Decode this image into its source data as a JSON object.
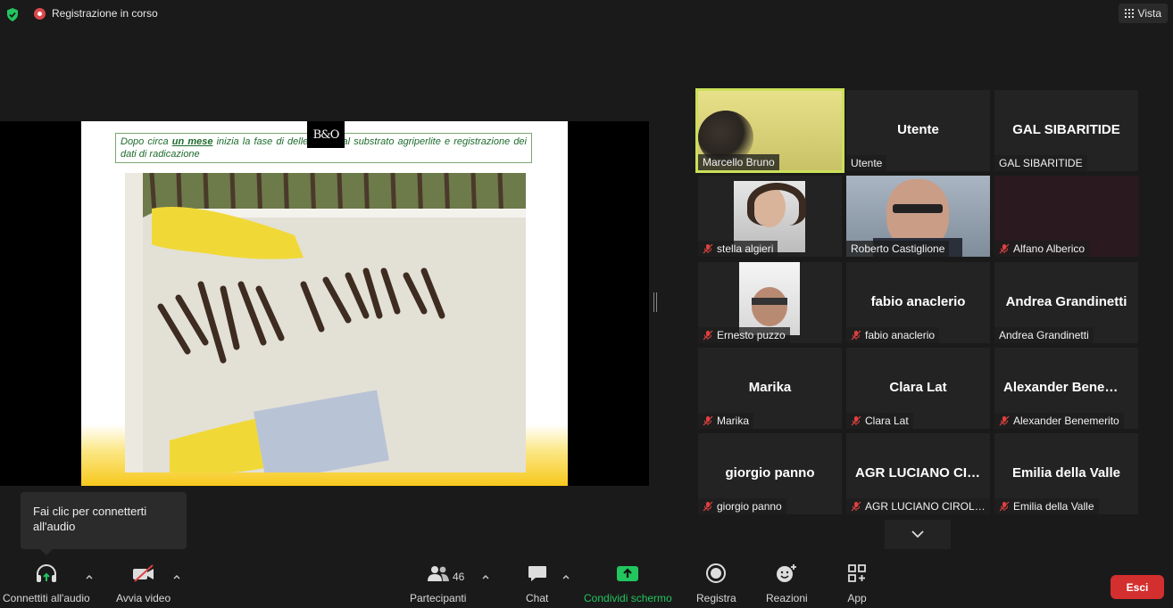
{
  "top_bar": {
    "recording_label": "Registrazione in corso",
    "view_label": "Vista"
  },
  "share": {
    "caption_pre": "Dopo circa ",
    "caption_bold": "un mese",
    "caption_post": " inizia la fase di         delle talee dal substrato agriperlite e registrazione dei dati di radicazione",
    "logo_text": "B&O"
  },
  "participants": [
    {
      "tile_name": "",
      "label": "Marcello Bruno",
      "muted": false,
      "video": true
    },
    {
      "tile_name": "Utente",
      "label": "Utente",
      "muted": false,
      "video": false
    },
    {
      "tile_name": "GAL SIBARITIDE",
      "label": "GAL SIBARITIDE",
      "muted": false,
      "video": false
    },
    {
      "tile_name": "",
      "label": "stella algieri",
      "muted": true,
      "video": true
    },
    {
      "tile_name": "",
      "label": "Roberto Castiglione",
      "muted": false,
      "video": true
    },
    {
      "tile_name": "",
      "label": "Alfano Alberico",
      "muted": true,
      "video": false
    },
    {
      "tile_name": "",
      "label": "Ernesto puzzo",
      "muted": true,
      "video": true
    },
    {
      "tile_name": "fabio anaclerio",
      "label": "fabio anaclerio",
      "muted": true,
      "video": false
    },
    {
      "tile_name": "Andrea  Grandinetti",
      "label": "Andrea Grandinetti",
      "muted": false,
      "video": false
    },
    {
      "tile_name": "Marika",
      "label": "Marika",
      "muted": true,
      "video": false
    },
    {
      "tile_name": "Clara Lat",
      "label": "Clara Lat",
      "muted": true,
      "video": false
    },
    {
      "tile_name": "Alexander  Benemerito",
      "label": "Alexander Benemerito",
      "muted": true,
      "video": false
    },
    {
      "tile_name": "giorgio panno",
      "label": "giorgio panno",
      "muted": true,
      "video": false
    },
    {
      "tile_name": "AGR LUCIANO CIROLLO",
      "label": "AGR LUCIANO CIROLLO",
      "muted": true,
      "video": false
    },
    {
      "tile_name": "Emilia della Valle",
      "label": "Emilia della Valle",
      "muted": true,
      "video": false
    }
  ],
  "tooltip": {
    "text": "Fai clic per connetterti all'audio"
  },
  "toolbar": {
    "audio_label": "Connettiti all'audio",
    "video_label": "Avvia video",
    "participants_label": "Partecipanti",
    "participants_count": "46",
    "chat_label": "Chat",
    "share_label": "Condividi schermo",
    "record_label": "Registra",
    "reactions_label": "Reazioni",
    "apps_label": "App",
    "leave_label": "Esci"
  },
  "colors": {
    "accent_green": "#22c55e",
    "active_border": "#cbe05a",
    "leave_red": "#d32f2f",
    "caption_green": "#1d6b2c"
  }
}
